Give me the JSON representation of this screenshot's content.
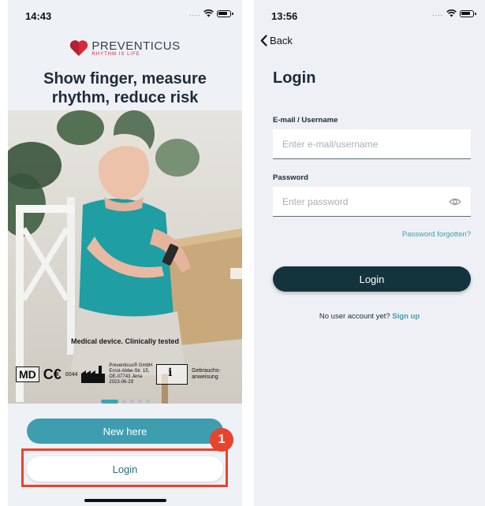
{
  "left_screen": {
    "status_time": "14:43",
    "brand_name": "PREVENTICUS",
    "brand_tagline": "RHYTHM IS LIFE",
    "headline": "Show finger, measure rhythm, reduce risk",
    "certification_caption": "Medical device. Clinically tested",
    "md_label": "MD",
    "ce_mark": "C€",
    "ce_number": "0044",
    "manufacturer_lines": [
      "Preventicus® GmbH",
      "Ernst-Abbe-Str. 15,",
      "DE-07743 Jena",
      "2023-06-29"
    ],
    "ifu_symbol": "i",
    "ifu_lines": [
      "Gebrauchs-",
      "anweisung"
    ],
    "pager": {
      "pages": 5,
      "active_index": 0
    },
    "new_here_label": "New here",
    "login_label": "Login",
    "step_marker": "1",
    "colors": {
      "accent": "#3e9eaf",
      "highlight": "#e8432d",
      "logo_red": "#d8283a"
    }
  },
  "right_screen": {
    "status_time": "13:56",
    "back_label": "Back",
    "title": "Login",
    "email_label": "E-mail / Username",
    "email_placeholder": "Enter e-mail/username",
    "email_value": "",
    "password_label": "Password",
    "password_placeholder": "Enter password",
    "password_value": "",
    "forgot_label": "Password forgotten?",
    "login_button_label": "Login",
    "no_account_text": "No user account yet?",
    "sign_up_label": "Sign up",
    "colors": {
      "button_dark": "#14343d",
      "link": "#3e9eaf"
    }
  }
}
